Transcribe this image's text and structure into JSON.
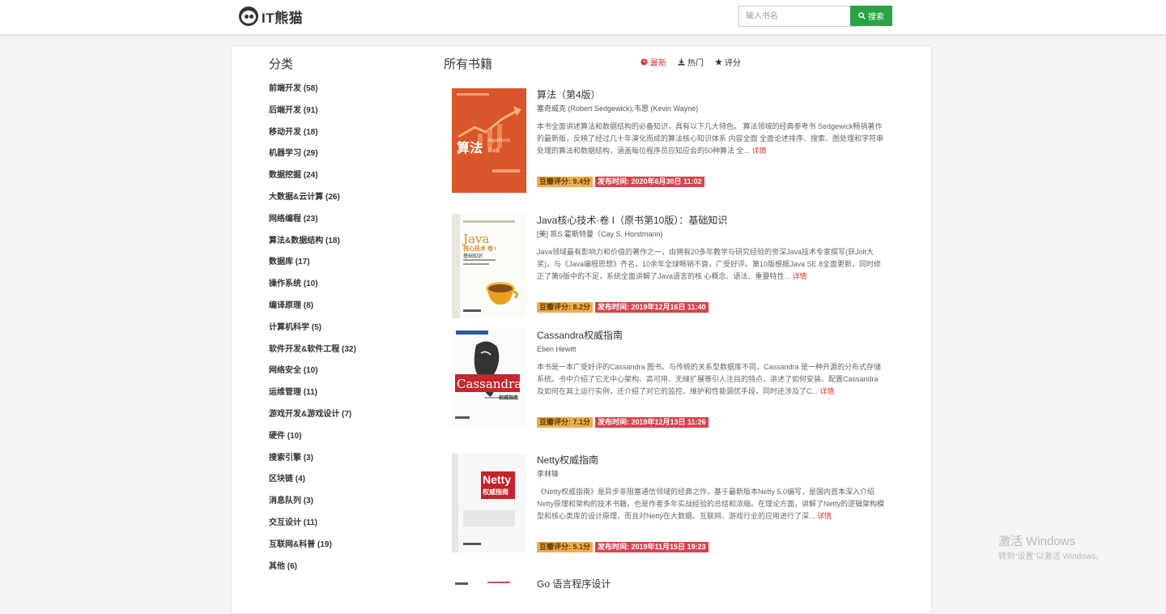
{
  "brand": {
    "name": "IT熊猫",
    "logo_icon": "panda-logo-icon"
  },
  "search": {
    "placeholder": "输入书名",
    "button_label": "搜索",
    "button_icon": "search-icon",
    "button_color": "#2aa145"
  },
  "categories": {
    "title": "分类",
    "items": [
      {
        "label": "前端开发 (58)"
      },
      {
        "label": "后端开发 (91)"
      },
      {
        "label": "移动开发 (18)"
      },
      {
        "label": "机器学习 (29)"
      },
      {
        "label": "数据挖掘 (24)"
      },
      {
        "label": "大数据&云计算 (26)"
      },
      {
        "label": "网络编程 (23)"
      },
      {
        "label": "算法&数据结构 (18)"
      },
      {
        "label": "数据库 (17)"
      },
      {
        "label": "操作系统 (10)"
      },
      {
        "label": "编译原理 (8)"
      },
      {
        "label": "计算机科学 (5)"
      },
      {
        "label": "软件开发&软件工程 (32)"
      },
      {
        "label": "网络安全 (10)"
      },
      {
        "label": "运维管理 (11)"
      },
      {
        "label": "游戏开发&游戏设计 (7)"
      },
      {
        "label": "硬件 (10)"
      },
      {
        "label": "搜索引擎 (3)"
      },
      {
        "label": "区块链 (4)"
      },
      {
        "label": "消息队列 (3)"
      },
      {
        "label": "交互设计 (11)"
      },
      {
        "label": "互联网&科普 (19)"
      },
      {
        "label": "其他 (6)"
      }
    ]
  },
  "books_section": {
    "title": "所有书籍",
    "sort": [
      {
        "label": "最新",
        "icon": "clock-icon",
        "active": true
      },
      {
        "label": "热门",
        "icon": "download-icon",
        "active": false
      },
      {
        "label": "评分",
        "icon": "star-icon",
        "active": false
      }
    ],
    "accent_color": "#e0332f"
  },
  "books": [
    {
      "title": "算法（第4版）",
      "author": "塞奇威克 (Robert Sedgewick),韦恩 (Kevin Wayne)",
      "desc": "本书全面讲述算法和数据结构的必备知识，具有以下几大特色。  算法领域的经典参考书 Sedgewick畅销著作的最新版，反映了经过几十年演化而成的算法核心知识体系  内容全面 全面论述排序、搜索、图处理和字符串处理的算法和数据结构，涵盖每位程序员应知应会的50种算法  全...",
      "detail": "详情",
      "score": "豆瓣评分: 9.4分",
      "date": "发布时间: 2020年6月30日 11:02",
      "cover_title": "算法",
      "cover_subtitle": "第4版",
      "cover_en": "Algorithms"
    },
    {
      "title": "Java核心技术·卷 I（原书第10版）：基础知识",
      "author": "[美] 凯S.霍斯特曼（Cay S. Horstmann)",
      "desc": "Java领域最有影响力和价值的著作之一，由拥有20多年教学与研究经验的资深Java技术专家撰写(获Jolt大奖)，与《Java编程思想》齐名，10余年全球畅销不衰，广受好评。第10版根据Java SE 8全面更新，同时修正了第9版中的不足，系统全面讲解了Java语言的核 心概念、语法、重要特性...",
      "detail": "详情",
      "score": "豆瓣评分: 8.2分",
      "date": "发布时间: 2019年12月16日 11:40",
      "cover_title": "Java",
      "cover_subtitle": "核心技术 卷 I",
      "cover_en": "基础知识"
    },
    {
      "title": "Cassandra权威指南",
      "author": "Eben Hewitt",
      "desc": "本书是一本广受好评的Cassandra 图书。与传统的关系型数据库不同，Cassandra 是一种开源的分布式存储系统。书中介绍了它无中心架构、高可用、无缝扩展等引人注目的特点，讲述了如何安装、配置Cassandra 及如何在其上运行实例，还介绍了对它的监控、维护和性能调优手段，同时还涉及了C...",
      "detail": "详情",
      "score": "豆瓣评分: 7.1分",
      "date": "发布时间: 2019年12月13日 11:26",
      "cover_title": "Cassandra",
      "cover_subtitle": "权威指南",
      "cover_en": ""
    },
    {
      "title": "Netty权威指南",
      "author": "李林锋",
      "desc": "《Netty权威指南》是异步非阻塞通信领域的经典之作，基于最新版本Netty 5.0编写，是国内首本深入介绍Netty原理和架构的技术书籍，也是作者多年实战经验的总结和浓缩。在理论方面，讲解了Netty的逻辑架构模型和核心类库的设计原理，而且对Netty在大数据、互联网、游戏行业的应用进行了深...",
      "detail": "详情",
      "score": "豆瓣评分: 5.1分",
      "date": "发布时间: 2019年11月15日 19:23",
      "cover_title": "Netty",
      "cover_subtitle": "权威指南",
      "cover_en": ""
    },
    {
      "title": "Go 语言程序设计",
      "author": "",
      "desc": "",
      "detail": "",
      "score": "",
      "date": "",
      "cover_title": "",
      "cover_subtitle": "",
      "cover_en": ""
    }
  ],
  "watermark": {
    "line1": "激活 Windows",
    "line2": "转到“设置”以激活 Windows。"
  }
}
